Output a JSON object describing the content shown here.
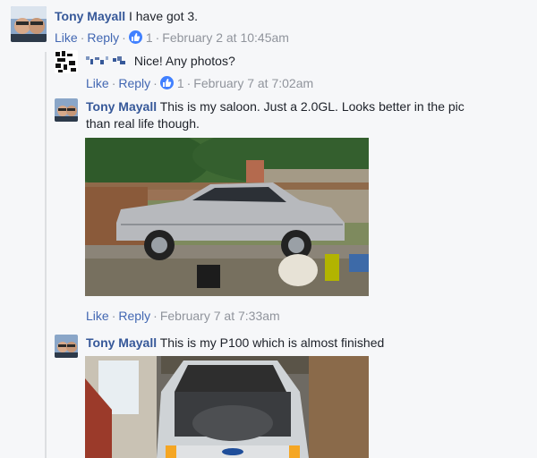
{
  "comments": [
    {
      "author": "Tony Mayall",
      "text": "I have got 3.",
      "actions": {
        "like": "Like",
        "reply": "Reply",
        "like_count": "1",
        "time": "February 2 at 10:45am"
      }
    },
    {
      "author": "",
      "text": "Nice! Any photos?",
      "actions": {
        "like": "Like",
        "reply": "Reply",
        "like_count": "1",
        "time": "February 7 at 7:02am"
      }
    },
    {
      "author": "Tony Mayall",
      "text_line1": "This is my saloon. Just a 2.0GL. Looks better in the pic",
      "text_line2": "than real life though.",
      "actions": {
        "like": "Like",
        "reply": "Reply",
        "time": "February 7 at 7:33am"
      }
    },
    {
      "author": "Tony Mayall",
      "text": "This is my P100 which is almost finished"
    }
  ],
  "colors": {
    "link": "#365899",
    "action": "#4267b2",
    "meta": "#90949c",
    "like_badge": "#4080ff"
  }
}
